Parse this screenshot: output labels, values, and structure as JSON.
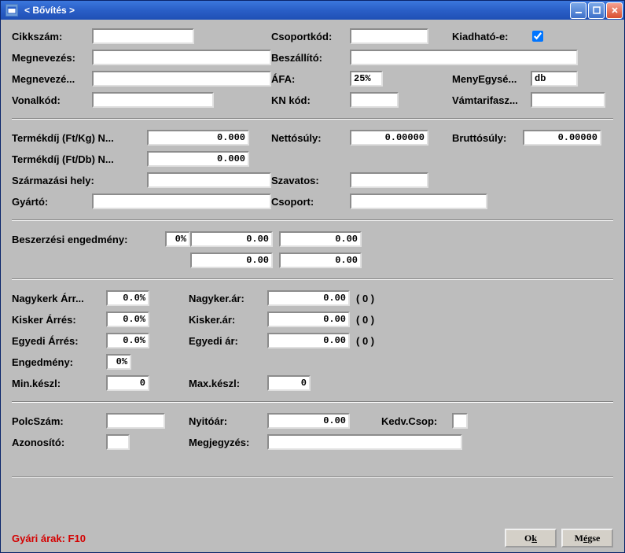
{
  "title": "<  Bővítés  >",
  "labels": {
    "cikkszam": "Cikkszám:",
    "csoportkod": "Csoportkód:",
    "kiadhato": "Kiadható-e:",
    "megnevezes": "Megnevezés:",
    "beszallito": "Beszállító:",
    "megneveze2": "Megnevezé...",
    "afa": "ÁFA:",
    "menyegyse": "MenyEgysé...",
    "vonalkod": "Vonalkód:",
    "knkod": "KN kód:",
    "vamtarifasz": "Vámtarifasz...",
    "termekdij_kg": "Termékdíj (Ft/Kg) N...",
    "nettosuly": "Nettósúly:",
    "bruttosuly": "Bruttósúly:",
    "termekdij_db": "Termékdíj (Ft/Db) N...",
    "szarmazasi": "Származási hely:",
    "szavatos": "Szavatos:",
    "gyarto": "Gyártó:",
    "csoport": "Csoport:",
    "beszerzesi": "Beszerzési engedmény:",
    "nagykerk_arr": "Nagykerk Árr...",
    "nagyker_ar": "Nagyker.ár:",
    "kisker_arres": "Kisker Árrés:",
    "kisker_ar": "Kisker.ár:",
    "egyedi_arres": "Egyedi Árrés:",
    "egyedi_ar": "Egyedi ár:",
    "engedmeny": "Engedmény:",
    "minkeszl": "Min.készl:",
    "maxkeszl": "Max.készl:",
    "polcszam": "PolcSzám:",
    "nyitoar": "Nyitóár:",
    "kedvcsop": "Kedv.Csop:",
    "azonosito": "Azonosító:",
    "megjegyzes": "Megjegyzés:"
  },
  "values": {
    "cikkszam": "",
    "csoportkod": "",
    "kiadhato": true,
    "megnevezes": "",
    "beszallito": "",
    "megneveze2": "",
    "afa": "25%",
    "menyegyse": "db",
    "vonalkod": "",
    "knkod": "",
    "vamtarifasz": "",
    "termekdij_kg": "0.000",
    "nettosuly": "0.00000",
    "bruttosuly": "0.00000",
    "termekdij_db": "0.000",
    "szarmazasi": "",
    "szavatos": "",
    "gyarto": "",
    "csoport": "",
    "beszerzesi_pct": "0%",
    "beszerzesi_v1": "0.00",
    "beszerzesi_v2": "0.00",
    "beszerzesi_v3": "0.00",
    "beszerzesi_v4": "0.00",
    "nagykerk_arr": "0.0%",
    "nagyker_ar": "0.00",
    "nagyker_suffix": "(  0  )",
    "kisker_arres": "0.0%",
    "kisker_ar": "0.00",
    "kisker_suffix": "(  0  )",
    "egyedi_arres": "0.0%",
    "egyedi_ar": "0.00",
    "egyedi_suffix": "(  0  )",
    "engedmeny": "0%",
    "minkeszl": "0",
    "maxkeszl": "0",
    "polcszam": "",
    "nyitoar": "0.00",
    "kedvcsop": "",
    "azonosito": "",
    "megjegyzes": ""
  },
  "footer": {
    "hint": "Gyári árak: F10",
    "ok_pre": "O",
    "ok_u": "k",
    "cancel_pre": "M",
    "cancel_u": "é",
    "cancel_post": "gse"
  }
}
